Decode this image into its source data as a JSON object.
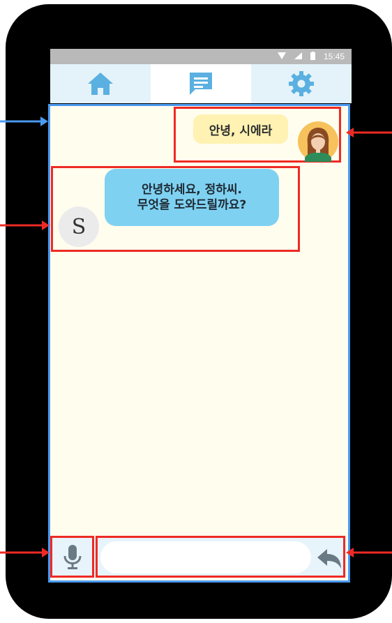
{
  "status_bar": {
    "time": "15:45",
    "icons": [
      "wifi-icon",
      "signal-icon",
      "battery-icon"
    ]
  },
  "tabs": [
    {
      "name": "home",
      "icon": "home-icon",
      "active": false
    },
    {
      "name": "chat",
      "icon": "chat-icon",
      "active": true
    },
    {
      "name": "settings",
      "icon": "gear-icon",
      "active": false
    }
  ],
  "conversation": {
    "user_message": "안녕, 시에라",
    "bot_message_line1": "안녕하세요, 정하씨.",
    "bot_message_line2": "무엇을 도와드릴까요?",
    "bot_avatar_letter": "S"
  },
  "input": {
    "value": "",
    "placeholder": ""
  },
  "colors": {
    "phone_body": "#000000",
    "chat_background": "#fffdee",
    "user_bubble": "#fff2b2",
    "bot_bubble": "#7fd1f2",
    "tab_bar": "#e4f3fa",
    "tab_icon": "#5ab0e0",
    "annotation_blue": "#4a9af0",
    "annotation_red": "#ee2a24"
  }
}
